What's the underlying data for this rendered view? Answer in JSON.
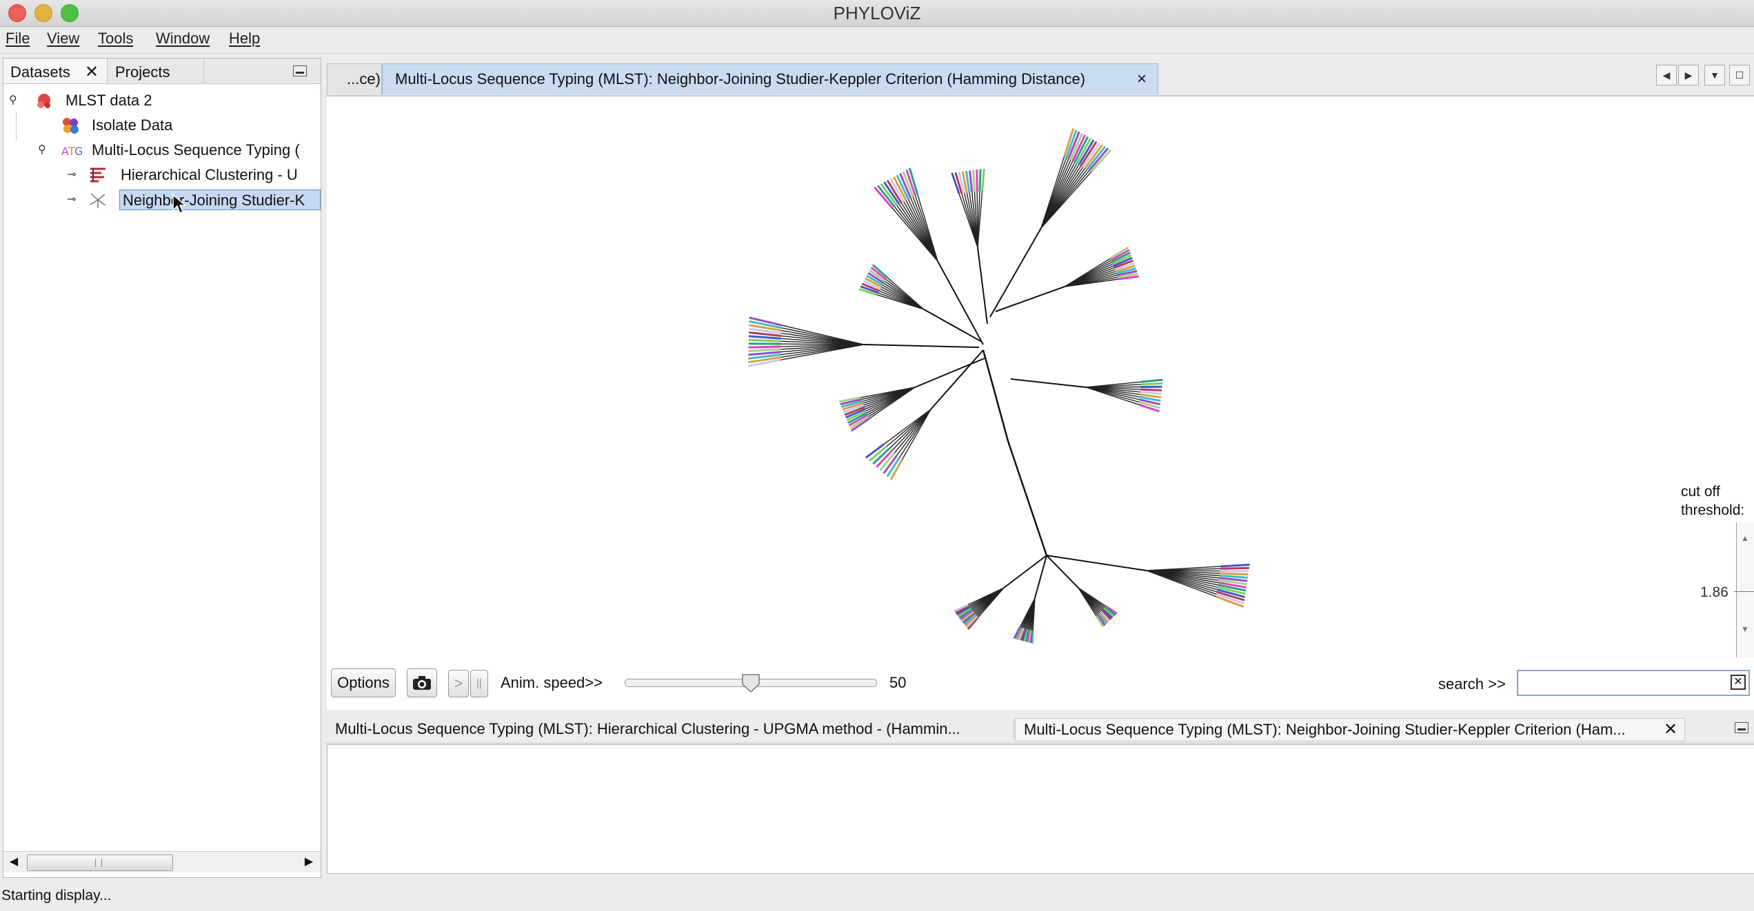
{
  "window": {
    "title": "PHYLOViZ"
  },
  "menu": [
    "File",
    "View",
    "Tools",
    "Window",
    "Help"
  ],
  "left_panel": {
    "tabs": [
      "Datasets",
      "Projects"
    ],
    "tree": [
      {
        "label": "MLST data 2"
      },
      {
        "label": "Isolate Data"
      },
      {
        "label": "Multi-Locus Sequence Typing ("
      },
      {
        "label": "Hierarchical Clustering  - U"
      },
      {
        "label": "Neighbor-Joining Studier-K"
      }
    ]
  },
  "main_tabs": {
    "collapsed": "...ce)",
    "active": "Multi-Locus Sequence Typing (MLST): Neighbor-Joining Studier-Keppler Criterion (Hamming Distance)",
    "close": "×"
  },
  "controls": {
    "options": "Options",
    "play": ">",
    "pause": "||",
    "anim_speed_label": "Anim. speed>>",
    "anim_speed_value": "50",
    "anim_speed_fraction": 0.5,
    "search_label": "search >>",
    "search_value": "",
    "cutoff_label_1": "cut off",
    "cutoff_label_2": "threshold:",
    "cutoff_value": "1.86"
  },
  "bottom_tabs": [
    {
      "label": "Multi-Locus Sequence Typing (MLST): Hierarchical Clustering  - UPGMA method - (Hammin..."
    },
    {
      "label": "Multi-Locus Sequence Typing (MLST): Neighbor-Joining Studier-Keppler Criterion (Ham..."
    }
  ],
  "status": {
    "text": "Starting display..."
  },
  "colors": {
    "accent_tab": "#c9dcf0",
    "selection": "#c6d9f2",
    "close_red": "#ec5f58",
    "minimize_yellow": "#e2b23f",
    "zoom_green": "#4fbf43"
  },
  "tree_colors": [
    "#e040c0",
    "#2b9c8c",
    "#7ad05a",
    "#4058c8",
    "#b33a5e",
    "#c8c8e8",
    "#d8a040",
    "#40b8c8",
    "#9050c0",
    "#a8d080"
  ]
}
